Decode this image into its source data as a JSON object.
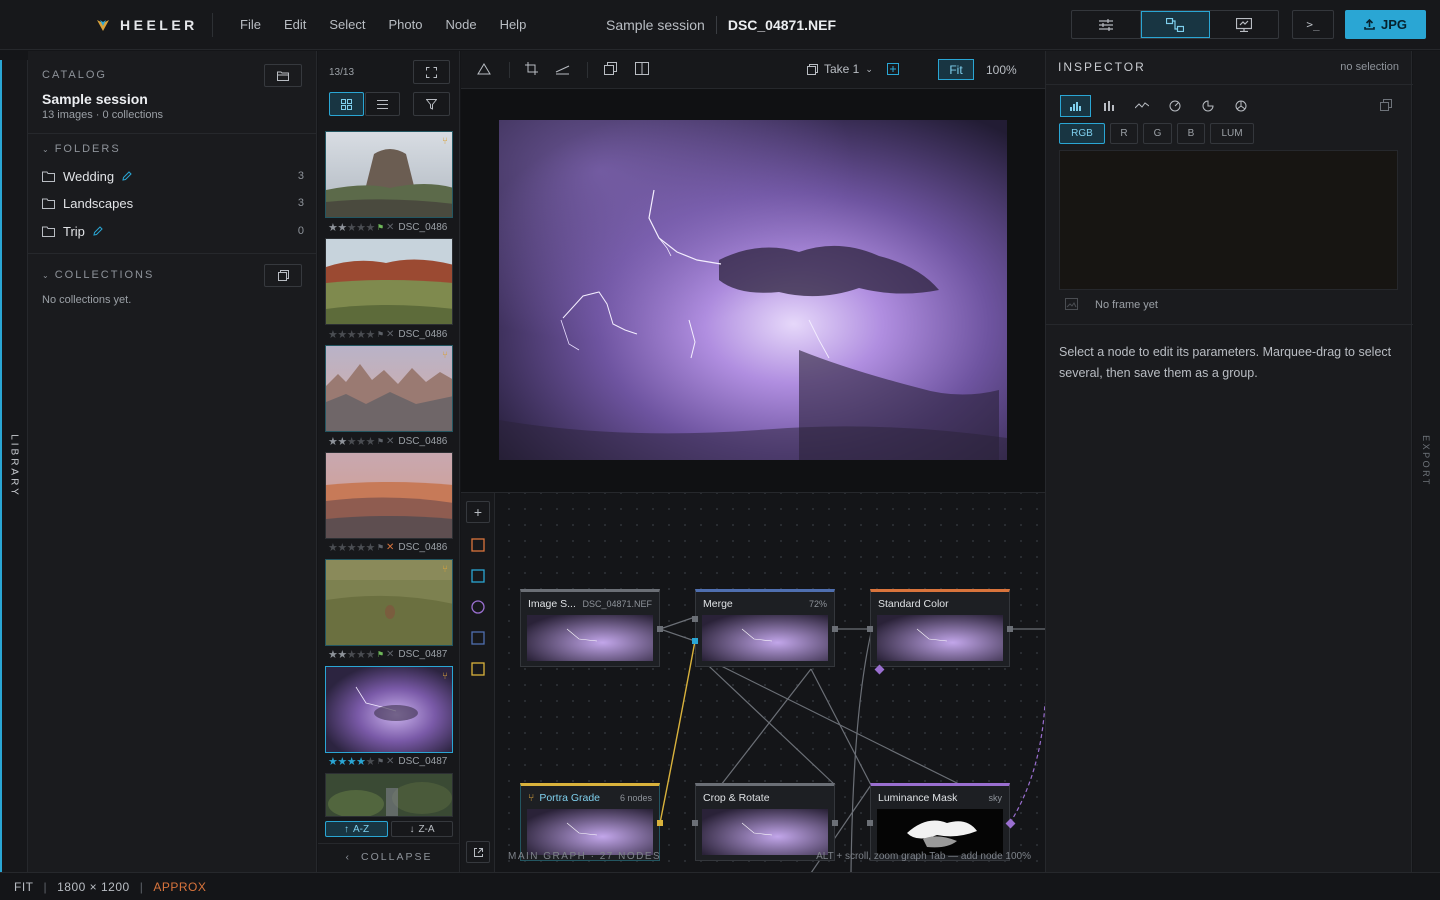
{
  "app": {
    "name": "HEELER"
  },
  "menu": [
    "File",
    "Edit",
    "Select",
    "Photo",
    "Node",
    "Help"
  ],
  "header": {
    "session": "Sample session",
    "filename": "DSC_04871.NEF",
    "export_label": "JPG",
    "terminal_label": ">_"
  },
  "catalog": {
    "caption": "CATALOG",
    "title": "Sample session",
    "subtitle": "13 images · 0 collections",
    "folders_caption": "FOLDERS",
    "folders": [
      {
        "name": "Wedding",
        "count": "3",
        "editable": true
      },
      {
        "name": "Landscapes",
        "count": "3",
        "editable": false
      },
      {
        "name": "Trip",
        "count": "0",
        "editable": true
      }
    ],
    "collections_caption": "COLLECTIONS",
    "collections_empty": "No collections yet."
  },
  "library_tab": "LIBRARY",
  "filmstrip": {
    "count": "13/13",
    "items": [
      {
        "name": "DSC_0486",
        "rating": 2,
        "flag": "pick"
      },
      {
        "name": "DSC_0486",
        "rating": 0,
        "flag": "none"
      },
      {
        "name": "DSC_0486",
        "rating": 2,
        "flag": "none"
      },
      {
        "name": "DSC_0486",
        "rating": 0,
        "flag": "reject"
      },
      {
        "name": "DSC_0487",
        "rating": 2,
        "flag": "pick"
      },
      {
        "name": "DSC_0487",
        "rating": 4,
        "flag": "none"
      }
    ],
    "sort_asc": "A-Z",
    "sort_desc": "Z-A",
    "collapse": "COLLAPSE"
  },
  "viewer_toolbar": {
    "take": "Take 1",
    "fit": "Fit",
    "zoom": "100%"
  },
  "graph": {
    "nodes": [
      {
        "id": "image-source",
        "title": "Image S...",
        "sub": "DSC_04871.NEF",
        "accent": "#6b6f76"
      },
      {
        "id": "merge",
        "title": "Merge",
        "sub": "72%",
        "accent": "#4f6fb0"
      },
      {
        "id": "standard-color",
        "title": "Standard Color",
        "sub": "",
        "accent": "#d9743c"
      },
      {
        "id": "portra-grade",
        "title": "Portra Grade",
        "sub": "6 nodes",
        "accent": "#d9b23c"
      },
      {
        "id": "crop-rotate",
        "title": "Crop & Rotate",
        "sub": "",
        "accent": "#6b6f76"
      },
      {
        "id": "luminance-mask",
        "title": "Luminance Mask",
        "sub": "sky",
        "accent": "#9a6fd0"
      }
    ],
    "footer_label": "MAIN GRAPH · 27 NODES",
    "help": "ALT + scroll, zoom graph   Tab — add node   100%"
  },
  "inspector": {
    "title": "INSPECTOR",
    "selection": "no selection",
    "channels": [
      "RGB",
      "R",
      "G",
      "B",
      "LUM"
    ],
    "no_frame": "No frame yet",
    "help": "Select a node to edit its parameters. Marquee-drag to select several, then save them as a group."
  },
  "export_tab": "EXPORT",
  "status": {
    "mode": "FIT",
    "dimensions": "1800 × 1200",
    "quality": "APPROX"
  },
  "colors": {
    "accent": "#2aa6d4",
    "warning": "#d9743c",
    "link": "#d9a23c"
  }
}
